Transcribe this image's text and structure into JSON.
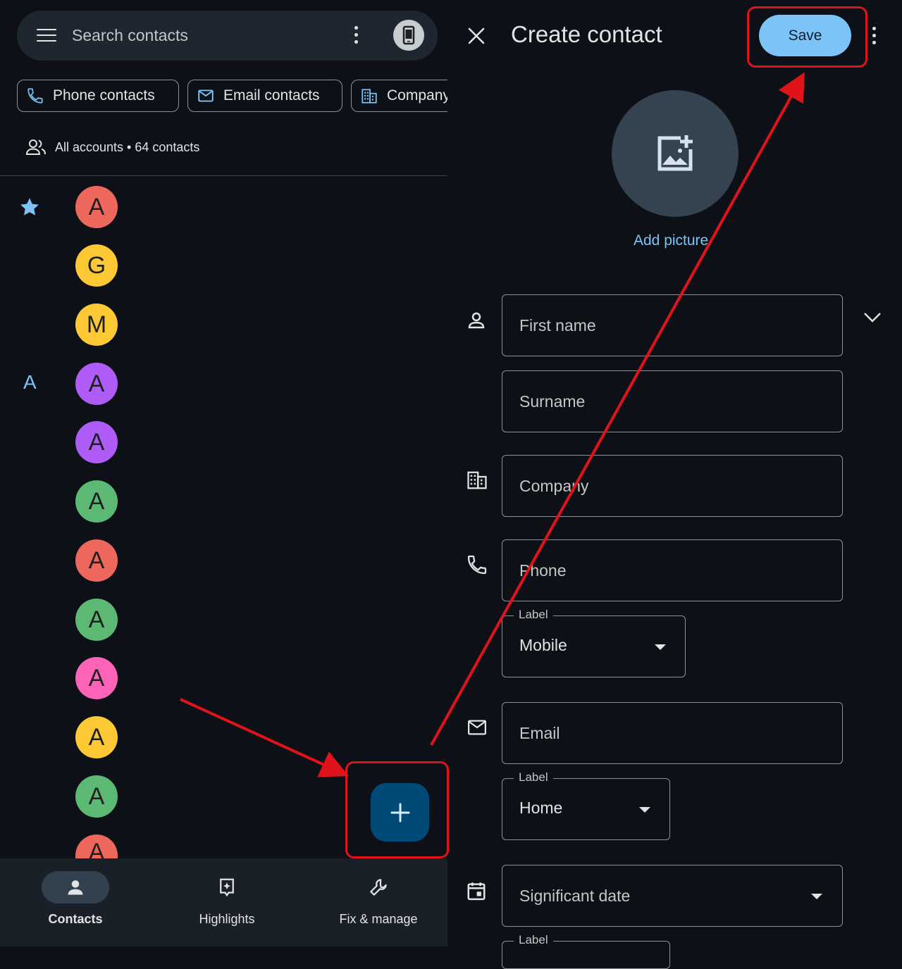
{
  "left": {
    "search_placeholder": "Search contacts",
    "chips": [
      "Phone contacts",
      "Email contacts",
      "Company"
    ],
    "accounts_summary": "All accounts • 64 contacts",
    "section_letter": "A",
    "avatars": [
      {
        "letter": "A",
        "color": "#ee675c"
      },
      {
        "letter": "G",
        "color": "#fcc934"
      },
      {
        "letter": "M",
        "color": "#fcc934"
      },
      {
        "letter": "A",
        "color": "#af5cf7"
      },
      {
        "letter": "A",
        "color": "#af5cf7"
      },
      {
        "letter": "A",
        "color": "#5bb974"
      },
      {
        "letter": "A",
        "color": "#ee675c"
      },
      {
        "letter": "A",
        "color": "#5bb974"
      },
      {
        "letter": "A",
        "color": "#ff63b8"
      },
      {
        "letter": "A",
        "color": "#fcc934"
      },
      {
        "letter": "A",
        "color": "#5bb974"
      },
      {
        "letter": "A",
        "color": "#ee675c"
      }
    ],
    "fab_icon": "plus-icon",
    "nav": [
      {
        "label": "Contacts",
        "icon": "person-icon",
        "active": true
      },
      {
        "label": "Highlights",
        "icon": "highlights-icon",
        "active": false
      },
      {
        "label": "Fix & manage",
        "icon": "wrench-icon",
        "active": false
      }
    ]
  },
  "right": {
    "title": "Create contact",
    "save_label": "Save",
    "add_picture": "Add picture",
    "fields": {
      "first_name": "First name",
      "surname": "Surname",
      "company": "Company",
      "phone": "Phone",
      "email": "Email",
      "significant_date": "Significant date"
    },
    "phone_label_legend": "Label",
    "phone_label_value": "Mobile",
    "email_label_legend": "Label",
    "email_label_value": "Home",
    "date_label_legend": "Label"
  },
  "colors": {
    "background": "#0d1117",
    "accent": "#7cc4f8",
    "fab": "#004a77",
    "annotation": "#e0131a"
  }
}
